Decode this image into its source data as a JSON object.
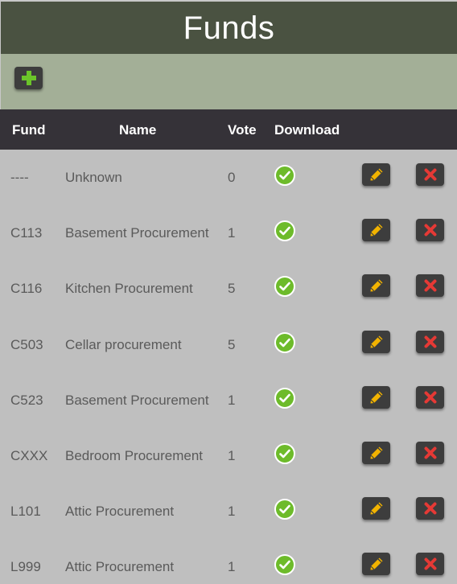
{
  "app": {
    "title": "Funds"
  },
  "colors": {
    "title_bg": "#4a5241",
    "toolbar_bg": "#a3af97",
    "header_bg": "#353238",
    "body_bg": "#bfbfbf",
    "add_icon": "#6bc42a",
    "download_icon": "#6dbb2a",
    "edit_icon": "#f2b300",
    "delete_icon": "#e53935"
  },
  "toolbar": {
    "add_icon": "plus-icon"
  },
  "table": {
    "headers": {
      "fund": "Fund",
      "name": "Name",
      "vote": "Vote",
      "download": "Download"
    },
    "rows": [
      {
        "fund": "----",
        "name": "Unknown",
        "vote": "0"
      },
      {
        "fund": "C113",
        "name": "Basement Procurement",
        "vote": "1"
      },
      {
        "fund": "C116",
        "name": "Kitchen Procurement",
        "vote": "5"
      },
      {
        "fund": "C503",
        "name": "Cellar procurement",
        "vote": "5"
      },
      {
        "fund": "C523",
        "name": "Basement Procurement",
        "vote": "1"
      },
      {
        "fund": "CXXX",
        "name": "Bedroom Procurement",
        "vote": "1"
      },
      {
        "fund": "L101",
        "name": "Attic Procurement",
        "vote": "1"
      },
      {
        "fund": "L999",
        "name": "Attic Procurement",
        "vote": "1"
      }
    ],
    "row_icons": {
      "download": "check-circle-icon",
      "edit": "pencil-icon",
      "delete": "x-icon"
    }
  }
}
